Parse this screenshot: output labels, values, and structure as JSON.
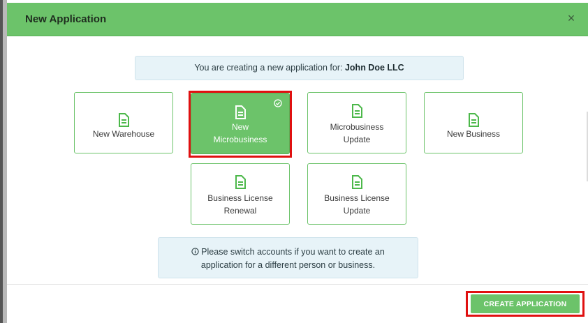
{
  "modal": {
    "title": "New Application",
    "close_label": "×"
  },
  "banner": {
    "prefix": "You are creating a new application for: ",
    "account_name": "John Doe LLC"
  },
  "application_types": [
    {
      "label_line1": "New Warehouse",
      "label_line2": "",
      "selected": false
    },
    {
      "label_line1": "New",
      "label_line2": "Microbusiness",
      "selected": true
    },
    {
      "label_line1": "Microbusiness",
      "label_line2": "Update",
      "selected": false
    },
    {
      "label_line1": "New Business",
      "label_line2": "",
      "selected": false
    },
    {
      "label_line1": "Business License",
      "label_line2": "Renewal",
      "selected": false
    },
    {
      "label_line1": "Business License",
      "label_line2": "Update",
      "selected": false
    }
  ],
  "note": {
    "line1": "Please switch accounts if you want to create an",
    "line2": "application for a different person or business."
  },
  "footer": {
    "create_label": "CREATE APPLICATION"
  },
  "colors": {
    "accent_green": "#6cc36a",
    "highlight_red": "#e01010",
    "info_bg": "#e7f3f8"
  },
  "icons": {
    "card_icon": "document-icon",
    "selected_icon": "check-circle-icon",
    "note_icon": "info-icon",
    "close_icon": "close-icon"
  }
}
